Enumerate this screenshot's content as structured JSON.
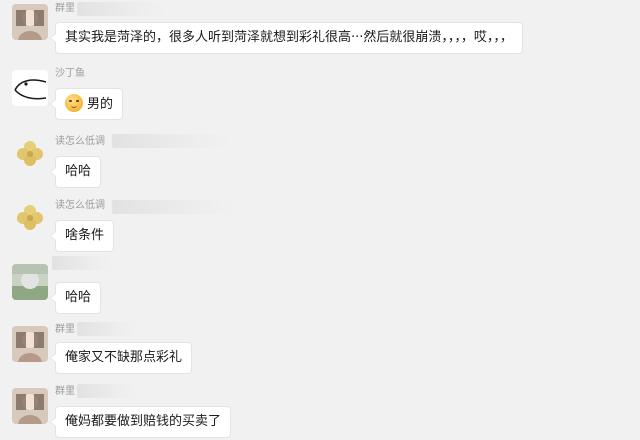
{
  "messages": [
    {
      "sender": "群里",
      "text": "其实我是菏泽的，很多人听到菏泽就想到彩礼很高···然后就很崩溃，，，，哎，，，"
    },
    {
      "sender": "沙丁鱼",
      "text": "男的"
    },
    {
      "sender": "读怎么低调",
      "text": "哈哈"
    },
    {
      "sender": "读怎么低调",
      "text": "啥条件"
    },
    {
      "sender": "",
      "text": "哈哈"
    },
    {
      "sender": "群里",
      "text": "俺家又不缺那点彩礼"
    },
    {
      "sender": "群里",
      "text": "俺妈都要做到赔钱的买卖了"
    }
  ]
}
